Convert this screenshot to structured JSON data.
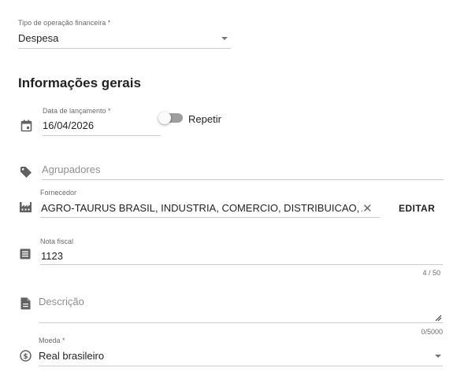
{
  "operation_type": {
    "label": "Tipo de operação financeira *",
    "value": "Despesa"
  },
  "section": {
    "title": "Informações gerais"
  },
  "launch_date": {
    "label": "Data de lançamento *",
    "value": "16/04/2026"
  },
  "repeat": {
    "label": "Repetir",
    "checked": false
  },
  "groupers": {
    "placeholder": "Agrupadores"
  },
  "supplier": {
    "label": "Fornecedor",
    "value": "AGRO-TAURUS BRASIL, INDUSTRIA, COMERCIO, DISTRIBUICAO, AGRO",
    "edit_label": "EDITAR"
  },
  "invoice": {
    "label": "Nota fiscal",
    "value": "1123",
    "counter": "4 / 50"
  },
  "description": {
    "placeholder": "Descrição",
    "counter": "0/5000"
  },
  "currency": {
    "label": "Moeda *",
    "value": "Real brasileiro"
  },
  "icons": {
    "date": "calendar-icon",
    "groupers": "tag-icon",
    "supplier": "factory-icon",
    "invoice": "list-icon",
    "description": "document-icon",
    "currency": "dollar-circle-icon"
  }
}
